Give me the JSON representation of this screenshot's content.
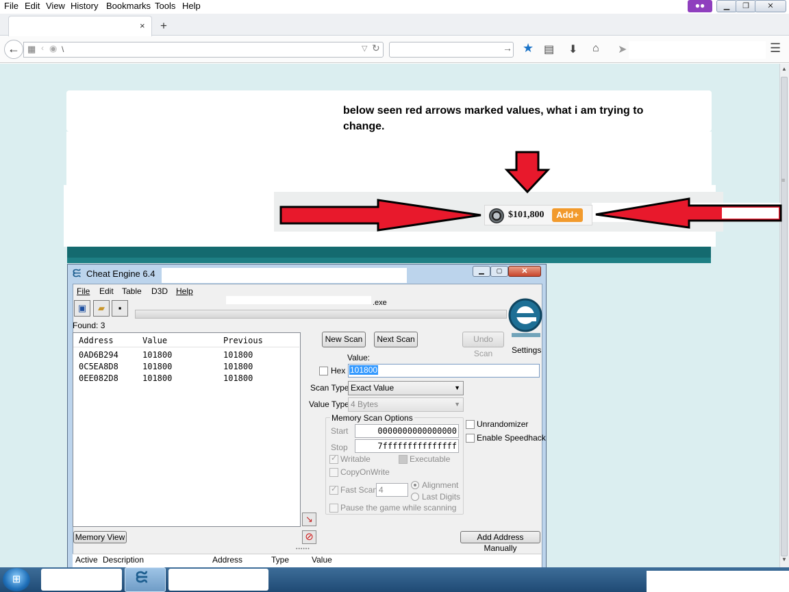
{
  "browser": {
    "menu": {
      "file": "File",
      "edit": "Edit",
      "view": "View",
      "history": "History",
      "bookmarks": "Bookmarks",
      "tools": "Tools",
      "help": "Help"
    },
    "tab": {
      "close": "×",
      "new_tab": "+"
    },
    "url_text": "\\",
    "icons": {
      "back": "back-arrow-icon",
      "private": "private-browsing-mask-icon",
      "bookmark": "star-icon",
      "library": "reading-list-icon",
      "download": "download-arrow-icon",
      "home": "home-icon",
      "send": "send-icon",
      "menu": "hamburger-menu-icon"
    }
  },
  "page": {
    "post_text": "below seen red arrows marked values, what i am trying to change.",
    "balance": {
      "amount": "$101,800",
      "add_button": "Add+"
    }
  },
  "cheat_engine": {
    "title": "Cheat Engine 6.4",
    "menu": {
      "file": "File",
      "edit": "Edit",
      "table": "Table",
      "d3d": "D3D",
      "help": "Help"
    },
    "process_suffix": ".exe",
    "found": "Found: 3",
    "results": {
      "columns": [
        "Address",
        "Value",
        "Previous"
      ],
      "rows": [
        {
          "address": "0AD6B294",
          "value": "101800",
          "previous": "101800"
        },
        {
          "address": "0C5EA8D8",
          "value": "101800",
          "previous": "101800"
        },
        {
          "address": "0EE082D8",
          "value": "101800",
          "previous": "101800"
        }
      ]
    },
    "buttons": {
      "new_scan": "New Scan",
      "next_scan": "Next Scan",
      "undo_scan": "Undo Scan",
      "memory_view": "Memory View",
      "add_address": "Add Address Manually"
    },
    "settings": "Settings",
    "value_label": "Value:",
    "hex_label": "Hex",
    "value": "101800",
    "scan_type_label": "Scan Type",
    "scan_type": "Exact Value",
    "value_type_label": "Value Type",
    "value_type": "4 Bytes",
    "memory_scan_options": {
      "title": "Memory Scan Options",
      "start_label": "Start",
      "start": "0000000000000000",
      "stop_label": "Stop",
      "stop": "7fffffffffffffff",
      "writable": "Writable",
      "executable": "Executable",
      "copy_on_write": "CopyOnWrite",
      "fast_scan": "Fast Scan",
      "fast_scan_value": "4",
      "alignment": "Alignment",
      "last_digits": "Last Digits",
      "pause": "Pause the game while scanning"
    },
    "unrandomizer": "Unrandomizer",
    "enable_speedhack": "Enable Speedhack",
    "address_list_columns": {
      "active": "Active",
      "description": "Description",
      "address": "Address",
      "type": "Type",
      "value": "Value"
    }
  },
  "colors": {
    "red_arrow": "#e8192c",
    "teal_bg": "#dbeef0",
    "ce_frame": "#bcd4ec",
    "add_orange": "#f29a2c"
  }
}
